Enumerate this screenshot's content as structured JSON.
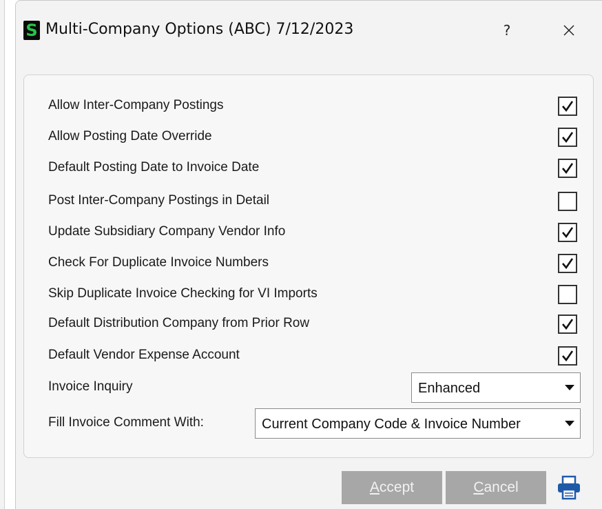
{
  "window": {
    "logo_letter": "S",
    "title": "Multi-Company Options (ABC) 7/12/2023",
    "help_label": "?"
  },
  "options": [
    {
      "label": "Allow Inter-Company Postings",
      "checked": true
    },
    {
      "label": "Allow Posting Date Override",
      "checked": true
    },
    {
      "label": "Default Posting Date to Invoice Date",
      "checked": true
    },
    {
      "label": "Post Inter-Company Postings in Detail",
      "checked": false
    },
    {
      "label": "Update Subsidiary Company Vendor Info",
      "checked": true
    },
    {
      "label": "Check For Duplicate Invoice Numbers",
      "checked": true
    },
    {
      "label": "Skip Duplicate Invoice Checking for VI Imports",
      "checked": false
    },
    {
      "label": "Default Distribution Company from Prior Row",
      "checked": true
    },
    {
      "label": "Default Vendor Expense Account",
      "checked": true
    }
  ],
  "invoice_inquiry": {
    "label": "Invoice Inquiry",
    "value": "Enhanced"
  },
  "fill_comment": {
    "label": "Fill Invoice Comment With:",
    "value": "Current Company Code & Invoice Number"
  },
  "buttons": {
    "accept_first": "A",
    "accept_rest": "ccept",
    "cancel_first": "C",
    "cancel_rest": "ancel"
  },
  "icons": {
    "logo": "sage-s-logo",
    "help": "question-mark",
    "close": "close-x",
    "print": "printer"
  },
  "colors": {
    "logo_bg": "#0a0a0a",
    "logo_fg": "#29c44a",
    "button_bg": "#a7a7a7",
    "print_icon": "#1f5aa8"
  }
}
